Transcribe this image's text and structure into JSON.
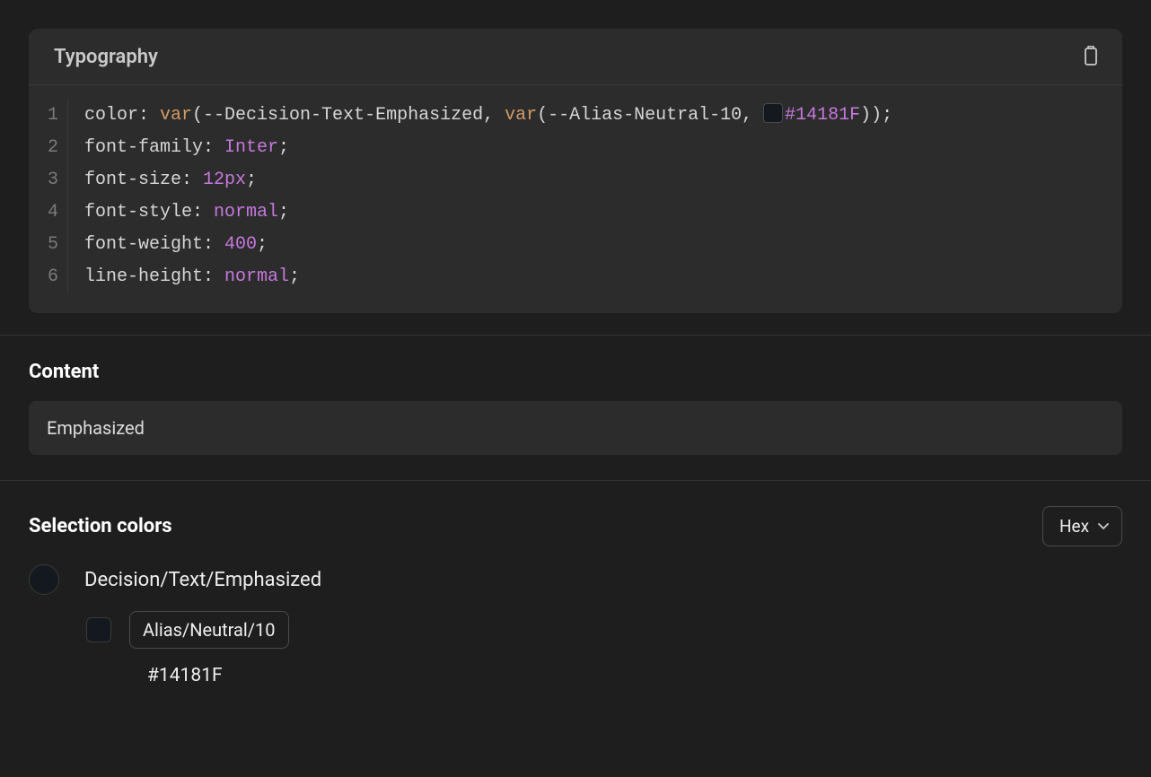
{
  "code": {
    "title": "Typography",
    "lines": [
      {
        "n": "1",
        "prop": "color",
        "fn1": "var",
        "arg1": "(--Decision-Text-Emphasized, ",
        "fn2": "var",
        "arg2": "(--Alias-Neutral-10, ",
        "hex": "#14181F",
        "tail": "));",
        "type": "color"
      },
      {
        "n": "2",
        "prop": "font-family",
        "val": "Inter",
        "tail": ";",
        "type": "ident"
      },
      {
        "n": "3",
        "prop": "font-size",
        "val": "12px",
        "tail": ";",
        "type": "num"
      },
      {
        "n": "4",
        "prop": "font-style",
        "val": "normal",
        "tail": ";",
        "type": "ident"
      },
      {
        "n": "5",
        "prop": "font-weight",
        "val": "400",
        "tail": ";",
        "type": "num"
      },
      {
        "n": "6",
        "prop": "line-height",
        "val": "normal",
        "tail": ";",
        "type": "ident"
      }
    ]
  },
  "content": {
    "title": "Content",
    "value": "Emphasized"
  },
  "selection_colors": {
    "title": "Selection colors",
    "format": "Hex",
    "primary": {
      "swatch": "#14181F",
      "label": "Decision/Text/Emphasized"
    },
    "alias": {
      "swatch": "#14181F",
      "label": "Alias/Neutral/10"
    },
    "hex": "#14181F"
  }
}
